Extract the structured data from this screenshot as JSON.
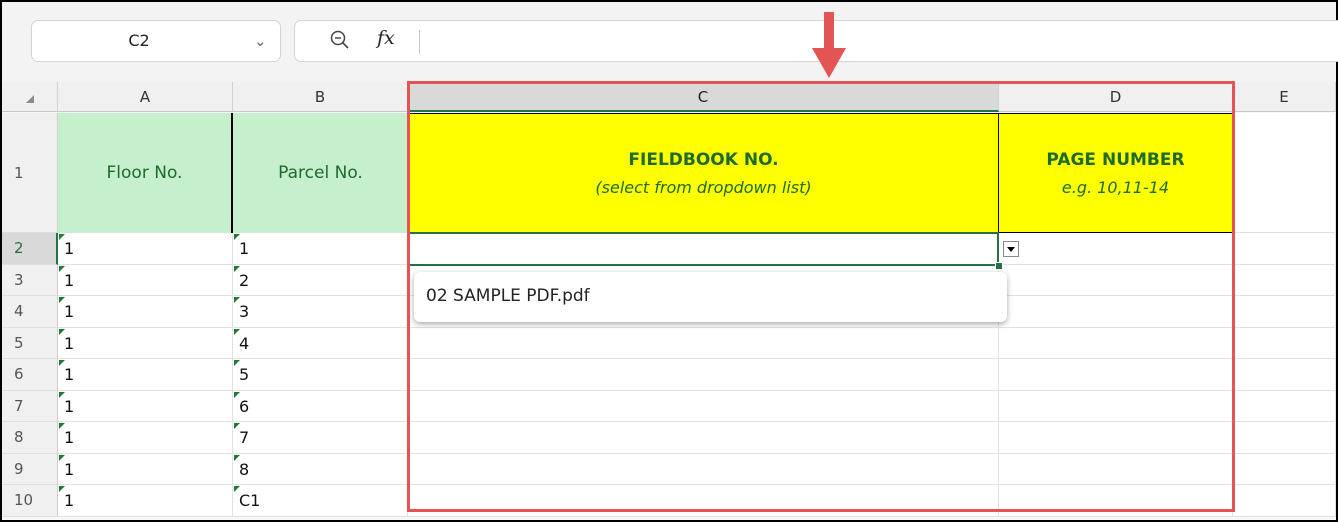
{
  "formula_bar": {
    "name_box": "C2",
    "fx_label": "fx",
    "formula": ""
  },
  "columns": [
    "A",
    "B",
    "C",
    "D",
    "E"
  ],
  "selected_column": "C",
  "header_row": {
    "a": "Floor No.",
    "b": "Parcel No.",
    "c_title": "FIELDBOOK NO.",
    "c_sub": "(select from dropdown list)",
    "d_title": "PAGE NUMBER",
    "d_sub": "e.g. 10,11-14"
  },
  "rows": [
    {
      "num": "2",
      "a": "1",
      "b": "1"
    },
    {
      "num": "3",
      "a": "1",
      "b": "2"
    },
    {
      "num": "4",
      "a": "1",
      "b": "3"
    },
    {
      "num": "5",
      "a": "1",
      "b": "4"
    },
    {
      "num": "6",
      "a": "1",
      "b": "5"
    },
    {
      "num": "7",
      "a": "1",
      "b": "6"
    },
    {
      "num": "8",
      "a": "1",
      "b": "7"
    },
    {
      "num": "9",
      "a": "1",
      "b": "8"
    },
    {
      "num": "10",
      "a": "1",
      "b": "C1"
    }
  ],
  "row1_num": "1",
  "dropdown": {
    "options": [
      "02 SAMPLE PDF.pdf"
    ]
  },
  "colors": {
    "header_green": "#c6efce",
    "header_yellow": "#ffff00",
    "header_text": "#1e6b2a",
    "selection": "#217346",
    "annotation_red": "#e35555"
  }
}
